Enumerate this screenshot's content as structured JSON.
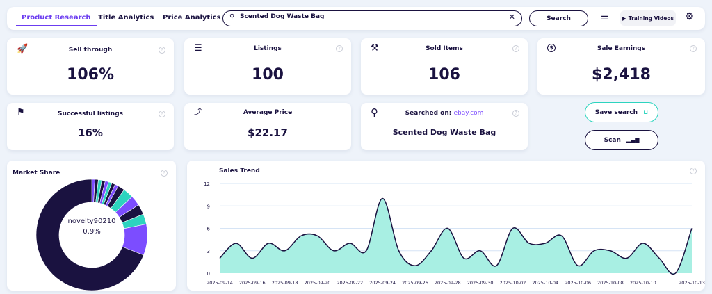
{
  "nav": {
    "tabs": [
      {
        "label": "Product Research",
        "active": true
      },
      {
        "label": "Title Analytics"
      },
      {
        "label": "Price Analytics"
      }
    ],
    "search_value": "Scented Dog Waste Bag",
    "search_button": "Search",
    "training_videos": "Training Videos"
  },
  "cards": {
    "sell_through": {
      "title": "Sell through",
      "value": "106%",
      "icon": "rocket-icon"
    },
    "listings": {
      "title": "Listings",
      "value": "100",
      "icon": "list-icon"
    },
    "sold_items": {
      "title": "Sold Items",
      "value": "106",
      "icon": "gavel-icon"
    },
    "sale_earnings": {
      "title": "Sale Earnings",
      "value": "$2,418",
      "icon": "dollar-icon"
    },
    "successful": {
      "title": "Successful listings",
      "value": "16%",
      "icon": "flag-icon"
    },
    "avg_price": {
      "title": "Average Price",
      "value": "$22.17",
      "icon": "trend-icon"
    },
    "searched": {
      "title": "Searched on:",
      "site": "ebay.com",
      "value": "Scented Dog Waste Bag",
      "icon": "search-icon"
    }
  },
  "actions": {
    "save": "Save search",
    "scan": "Scan"
  },
  "colors": {
    "accent": "#6b3cf0",
    "teal": "#2dd4bf",
    "navy": "#1a1240",
    "fill": "#a8efe3"
  },
  "chart_data": [
    {
      "type": "pie",
      "title": "Market Share",
      "center_label": "novelty90210",
      "center_value": "0.9%",
      "values": [
        0.9,
        1,
        1,
        1,
        1,
        1,
        1,
        1,
        2,
        3,
        3,
        3,
        3,
        9,
        69.1
      ],
      "colors": [
        "#7c4dff",
        "#1a1240",
        "#2dd4bf",
        "#1a1240",
        "#7c4dff",
        "#2dd4bf",
        "#1a1240",
        "#7c4dff",
        "#1a1240",
        "#2dd4bf",
        "#7c4dff",
        "#1a1240",
        "#2dd4bf",
        "#7c4dff",
        "#1a1240"
      ]
    },
    {
      "type": "area",
      "title": "Sales Trend",
      "ylim": [
        0,
        12
      ],
      "yticks": [
        0,
        3,
        6,
        9,
        12
      ],
      "grid": true,
      "x": [
        "2025-09-14",
        "2025-09-15",
        "2025-09-16",
        "2025-09-17",
        "2025-09-18",
        "2025-09-19",
        "2025-09-20",
        "2025-09-21",
        "2025-09-22",
        "2025-09-23",
        "2025-09-24",
        "2025-09-25",
        "2025-09-26",
        "2025-09-27",
        "2025-09-28",
        "2025-09-29",
        "2025-09-30",
        "2025-10-01",
        "2025-10-02",
        "2025-10-03",
        "2025-10-04",
        "2025-10-05",
        "2025-10-06",
        "2025-10-07",
        "2025-10-08",
        "2025-10-09",
        "2025-10-10",
        "2025-10-11",
        "2025-10-12",
        "2025-10-13"
      ],
      "xticks": [
        "2025-09-14",
        "2025-09-16",
        "2025-09-18",
        "2025-09-20",
        "2025-09-22",
        "2025-09-24",
        "2025-09-26",
        "2025-09-28",
        "2025-09-30",
        "2025-10-02",
        "2025-10-04",
        "2025-10-06",
        "2025-10-08",
        "2025-10-10",
        "2025-10-13"
      ],
      "values": [
        2,
        4,
        2,
        4,
        3,
        5,
        5,
        3,
        4,
        3,
        10,
        3,
        1,
        3,
        6,
        2,
        3,
        1,
        6,
        4,
        4,
        5,
        1,
        3,
        3,
        2,
        4,
        2,
        0,
        6
      ]
    }
  ]
}
